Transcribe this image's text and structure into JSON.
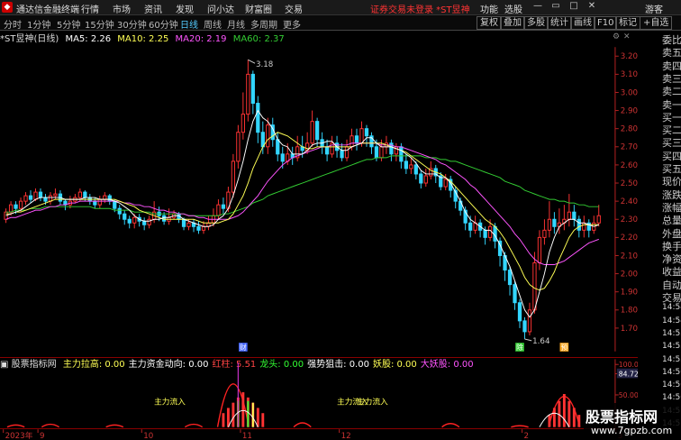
{
  "titlebar": {
    "app_name": "通达信金融终端",
    "menus": [
      "行情",
      "市场",
      "资讯",
      "发现",
      "问小达",
      "财富圈",
      "交易"
    ],
    "alert": "证券交易未登录 *ST昱神",
    "right_menus": [
      "功能",
      "选股",
      "游客"
    ]
  },
  "toolbar": {
    "periods": [
      "分时",
      "1分钟",
      "5分钟",
      "15分钟",
      "30分钟",
      "60分钟",
      "日线",
      "周线",
      "月线",
      "多周期",
      "更多"
    ],
    "active_period": "日线",
    "tools": [
      "复权",
      "叠加",
      "多股",
      "统计",
      "画线",
      "F10",
      "标记"
    ],
    "self_select": "+自选"
  },
  "chart_info": {
    "stock": "*ST昱神(日线)",
    "ma5_label": "MA5: 2.26",
    "ma10_label": "MA10: 2.25",
    "ma20_label": "MA20: 2.19",
    "ma60_label": "MA60: 2.37"
  },
  "colors": {
    "up": "#ff3333",
    "down": "#33d6ff",
    "ma5": "#ffffff",
    "ma10": "#ffff55",
    "ma20": "#ff55ff",
    "ma60": "#33cc33",
    "axis": "#cc2222"
  },
  "price_axis": [
    "3.20",
    "3.10",
    "3.00",
    "2.90",
    "2.80",
    "2.70",
    "2.60",
    "2.50",
    "2.40",
    "2.30",
    "2.20",
    "2.10",
    "2.00",
    "1.90",
    "1.80",
    "1.70"
  ],
  "annotations": {
    "high": "3.18",
    "low": "1.64"
  },
  "markers": [
    "财",
    "除",
    "预"
  ],
  "indicator": {
    "name": "股票指标网",
    "items": [
      {
        "label": "主力拉高:",
        "value": "0.00",
        "color": "#ffff55"
      },
      {
        "label": "主力资金动向:",
        "value": "0.00",
        "color": "#ffffff"
      },
      {
        "label": "红柱:",
        "value": "5.51",
        "color": "#ff4444"
      },
      {
        "label": "龙头:",
        "value": "0.00",
        "color": "#33ff33"
      },
      {
        "label": "强势狙击:",
        "value": "0.00",
        "color": "#ffffff"
      },
      {
        "label": "妖股:",
        "value": "0.00",
        "color": "#ffff55"
      },
      {
        "label": "大妖股:",
        "value": "0.00",
        "color": "#ff55ff"
      }
    ],
    "axis": [
      "100.00",
      "84.72",
      "50.00"
    ],
    "flow_labels": [
      "主力流入",
      "主力流入",
      "主力流入"
    ]
  },
  "date_axis": [
    "2023年",
    "9",
    "10",
    "11",
    "12",
    "2",
    "3"
  ],
  "right_panel": [
    "委比",
    "卖五",
    "卖四",
    "卖三",
    "卖二",
    "卖一",
    "买一",
    "买二",
    "买三",
    "买四",
    "买五",
    "现价",
    "涨跌",
    "涨幅",
    "总量",
    "外盘",
    "换手",
    "净资",
    "收益",
    "自动",
    "交易",
    "14:54",
    "14:54",
    "14:55",
    "14:55",
    "14:55",
    "14:56",
    "14:56",
    "14:56",
    "14:5",
    "14:5"
  ],
  "watermark": {
    "title": "股票指标网",
    "url": "www.7gpzb.com"
  },
  "chart_data": {
    "type": "candlestick",
    "x": [
      "2023-08",
      "2023-09",
      "2023-10",
      "2023-11",
      "2023-12",
      "2024-01",
      "2024-02",
      "2024-03"
    ],
    "candles": [
      [
        2.3,
        2.34,
        2.36,
        2.28
      ],
      [
        2.34,
        2.38,
        2.4,
        2.32
      ],
      [
        2.38,
        2.36,
        2.4,
        2.33
      ],
      [
        2.36,
        2.4,
        2.42,
        2.34
      ],
      [
        2.4,
        2.43,
        2.45,
        2.38
      ],
      [
        2.43,
        2.41,
        2.46,
        2.39
      ],
      [
        2.41,
        2.45,
        2.47,
        2.4
      ],
      [
        2.45,
        2.42,
        2.47,
        2.4
      ],
      [
        2.42,
        2.4,
        2.44,
        2.38
      ],
      [
        2.4,
        2.43,
        2.45,
        2.38
      ],
      [
        2.43,
        2.44,
        2.47,
        2.41
      ],
      [
        2.44,
        2.4,
        2.46,
        2.38
      ],
      [
        2.4,
        2.38,
        2.41,
        2.35
      ],
      [
        2.38,
        2.4,
        2.43,
        2.36
      ],
      [
        2.4,
        2.42,
        2.44,
        2.39
      ],
      [
        2.42,
        2.45,
        2.47,
        2.4
      ],
      [
        2.45,
        2.42,
        2.46,
        2.4
      ],
      [
        2.42,
        2.4,
        2.44,
        2.38
      ],
      [
        2.4,
        2.38,
        2.42,
        2.36
      ],
      [
        2.38,
        2.41,
        2.43,
        2.36
      ],
      [
        2.41,
        2.43,
        2.45,
        2.39
      ],
      [
        2.43,
        2.4,
        2.44,
        2.38
      ],
      [
        2.4,
        2.36,
        2.41,
        2.34
      ],
      [
        2.36,
        2.33,
        2.38,
        2.3
      ],
      [
        2.33,
        2.3,
        2.35,
        2.27
      ],
      [
        2.3,
        2.28,
        2.32,
        2.25
      ],
      [
        2.28,
        2.31,
        2.33,
        2.25
      ],
      [
        2.31,
        2.29,
        2.33,
        2.26
      ],
      [
        2.29,
        2.27,
        2.31,
        2.24
      ],
      [
        2.27,
        2.3,
        2.32,
        2.25
      ],
      [
        2.3,
        2.34,
        2.4,
        2.28
      ],
      [
        2.34,
        2.32,
        2.37,
        2.29
      ],
      [
        2.32,
        2.29,
        2.34,
        2.27
      ],
      [
        2.29,
        2.31,
        2.36,
        2.27
      ],
      [
        2.31,
        2.33,
        2.35,
        2.3
      ],
      [
        2.33,
        2.3,
        2.34,
        2.28
      ],
      [
        2.3,
        2.26,
        2.31,
        2.24
      ],
      [
        2.26,
        2.28,
        2.3,
        2.24
      ],
      [
        2.28,
        2.26,
        2.3,
        2.23
      ],
      [
        2.26,
        2.24,
        2.29,
        2.22
      ],
      [
        2.24,
        2.26,
        2.29,
        2.22
      ],
      [
        2.26,
        2.28,
        2.32,
        2.24
      ],
      [
        2.28,
        2.32,
        2.36,
        2.26
      ],
      [
        2.32,
        2.38,
        2.41,
        2.3
      ],
      [
        2.38,
        2.36,
        2.42,
        2.33
      ],
      [
        2.36,
        2.45,
        2.48,
        2.34
      ],
      [
        2.45,
        2.62,
        2.66,
        2.42
      ],
      [
        2.62,
        2.78,
        2.82,
        2.58
      ],
      [
        2.78,
        2.88,
        3.0,
        2.74
      ],
      [
        2.88,
        3.1,
        3.18,
        2.84
      ],
      [
        3.1,
        2.94,
        3.12,
        2.88
      ],
      [
        2.94,
        2.78,
        2.98,
        2.72
      ],
      [
        2.78,
        2.7,
        2.84,
        2.66
      ],
      [
        2.7,
        2.82,
        2.86,
        2.66
      ],
      [
        2.82,
        2.74,
        2.86,
        2.7
      ],
      [
        2.74,
        2.66,
        2.78,
        2.62
      ],
      [
        2.66,
        2.62,
        2.7,
        2.58
      ],
      [
        2.62,
        2.66,
        2.72,
        2.6
      ],
      [
        2.66,
        2.64,
        2.7,
        2.6
      ],
      [
        2.64,
        2.7,
        2.76,
        2.62
      ],
      [
        2.7,
        2.68,
        2.76,
        2.64
      ],
      [
        2.68,
        2.72,
        2.78,
        2.66
      ],
      [
        2.72,
        2.84,
        2.9,
        2.7
      ],
      [
        2.84,
        2.74,
        2.86,
        2.7
      ],
      [
        2.74,
        2.7,
        2.78,
        2.66
      ],
      [
        2.7,
        2.66,
        2.74,
        2.62
      ],
      [
        2.66,
        2.72,
        2.76,
        2.64
      ],
      [
        2.72,
        2.68,
        2.76,
        2.64
      ],
      [
        2.68,
        2.64,
        2.72,
        2.62
      ],
      [
        2.64,
        2.7,
        2.74,
        2.62
      ],
      [
        2.7,
        2.76,
        2.8,
        2.68
      ],
      [
        2.76,
        2.72,
        2.8,
        2.68
      ],
      [
        2.72,
        2.8,
        2.84,
        2.7
      ],
      [
        2.8,
        2.76,
        2.82,
        2.7
      ],
      [
        2.76,
        2.7,
        2.78,
        2.66
      ],
      [
        2.7,
        2.64,
        2.74,
        2.62
      ],
      [
        2.64,
        2.7,
        2.74,
        2.62
      ],
      [
        2.7,
        2.72,
        2.76,
        2.66
      ],
      [
        2.72,
        2.66,
        2.74,
        2.62
      ],
      [
        2.66,
        2.7,
        2.72,
        2.62
      ],
      [
        2.7,
        2.62,
        2.72,
        2.58
      ],
      [
        2.62,
        2.58,
        2.66,
        2.55
      ],
      [
        2.58,
        2.6,
        2.64,
        2.55
      ],
      [
        2.6,
        2.55,
        2.62,
        2.52
      ],
      [
        2.55,
        2.5,
        2.57,
        2.47
      ],
      [
        2.5,
        2.54,
        2.58,
        2.48
      ],
      [
        2.54,
        2.58,
        2.62,
        2.52
      ],
      [
        2.58,
        2.54,
        2.6,
        2.5
      ],
      [
        2.54,
        2.48,
        2.56,
        2.46
      ],
      [
        2.48,
        2.52,
        2.55,
        2.46
      ],
      [
        2.52,
        2.46,
        2.54,
        2.42
      ],
      [
        2.46,
        2.4,
        2.48,
        2.36
      ],
      [
        2.4,
        2.35,
        2.42,
        2.32
      ],
      [
        2.35,
        2.28,
        2.37,
        2.24
      ],
      [
        2.28,
        2.24,
        2.32,
        2.2
      ],
      [
        2.24,
        2.28,
        2.32,
        2.22
      ],
      [
        2.28,
        2.24,
        2.3,
        2.2
      ],
      [
        2.24,
        2.2,
        2.26,
        2.16
      ],
      [
        2.2,
        2.26,
        2.3,
        2.18
      ],
      [
        2.26,
        2.18,
        2.28,
        2.14
      ],
      [
        2.18,
        2.1,
        2.2,
        2.04
      ],
      [
        2.1,
        2.02,
        2.12,
        1.96
      ],
      [
        2.02,
        1.94,
        2.04,
        1.88
      ],
      [
        1.94,
        1.84,
        1.96,
        1.8
      ],
      [
        1.84,
        1.74,
        1.86,
        1.7
      ],
      [
        1.74,
        1.68,
        1.76,
        1.64
      ],
      [
        1.68,
        1.8,
        1.84,
        1.66
      ],
      [
        1.8,
        2.06,
        2.12,
        1.78
      ],
      [
        2.06,
        2.2,
        2.24,
        2.02
      ],
      [
        2.2,
        2.24,
        2.3,
        2.16
      ],
      [
        2.24,
        2.3,
        2.4,
        2.2
      ],
      [
        2.3,
        2.26,
        2.34,
        2.22
      ],
      [
        2.26,
        2.28,
        2.36,
        2.22
      ],
      [
        2.28,
        2.3,
        2.38,
        2.24
      ],
      [
        2.3,
        2.34,
        2.44,
        2.26
      ],
      [
        2.34,
        2.3,
        2.38,
        2.26
      ],
      [
        2.3,
        2.24,
        2.32,
        2.2
      ],
      [
        2.24,
        2.28,
        2.32,
        2.2
      ],
      [
        2.28,
        2.24,
        2.3,
        2.2
      ],
      [
        2.24,
        2.28,
        2.32,
        2.22
      ],
      [
        2.28,
        2.32,
        2.38,
        2.26
      ]
    ],
    "ma5": [
      2.32,
      2.33,
      2.34,
      2.35,
      2.37,
      2.39,
      2.41,
      2.42,
      2.42,
      2.42,
      2.42,
      2.42,
      2.41,
      2.41,
      2.41,
      2.41,
      2.42,
      2.42,
      2.42,
      2.41,
      2.41,
      2.41,
      2.4,
      2.39,
      2.37,
      2.35,
      2.32,
      2.3,
      2.29,
      2.29,
      2.3,
      2.3,
      2.31,
      2.31,
      2.32,
      2.32,
      2.3,
      2.29,
      2.28,
      2.27,
      2.26,
      2.26,
      2.27,
      2.3,
      2.32,
      2.36,
      2.43,
      2.52,
      2.62,
      2.74,
      2.84,
      2.9,
      2.86,
      2.84,
      2.8,
      2.74,
      2.71,
      2.7,
      2.66,
      2.66,
      2.66,
      2.68,
      2.71,
      2.72,
      2.72,
      2.73,
      2.73,
      2.7,
      2.68,
      2.68,
      2.7,
      2.71,
      2.72,
      2.75,
      2.75,
      2.72,
      2.7,
      2.7,
      2.7,
      2.69,
      2.68,
      2.66,
      2.64,
      2.61,
      2.57,
      2.55,
      2.55,
      2.55,
      2.53,
      2.53,
      2.5,
      2.45,
      2.4,
      2.34,
      2.3,
      2.28,
      2.26,
      2.24,
      2.24,
      2.21,
      2.16,
      2.1,
      2.04,
      1.96,
      1.88,
      1.8,
      1.76,
      1.8,
      1.9,
      2.0,
      2.12,
      2.2,
      2.26,
      2.28,
      2.3,
      2.3,
      2.28,
      2.28,
      2.27,
      2.26,
      2.27
    ],
    "ma10": [
      2.33,
      2.33,
      2.34,
      2.34,
      2.35,
      2.36,
      2.37,
      2.38,
      2.39,
      2.4,
      2.41,
      2.41,
      2.41,
      2.41,
      2.41,
      2.41,
      2.41,
      2.41,
      2.41,
      2.41,
      2.41,
      2.41,
      2.41,
      2.4,
      2.39,
      2.38,
      2.37,
      2.35,
      2.34,
      2.33,
      2.32,
      2.31,
      2.3,
      2.3,
      2.3,
      2.3,
      2.3,
      2.3,
      2.3,
      2.29,
      2.28,
      2.28,
      2.28,
      2.28,
      2.29,
      2.3,
      2.33,
      2.38,
      2.43,
      2.5,
      2.58,
      2.64,
      2.7,
      2.74,
      2.76,
      2.78,
      2.77,
      2.76,
      2.74,
      2.72,
      2.7,
      2.69,
      2.69,
      2.7,
      2.7,
      2.7,
      2.7,
      2.7,
      2.7,
      2.7,
      2.7,
      2.71,
      2.72,
      2.72,
      2.72,
      2.72,
      2.72,
      2.71,
      2.7,
      2.69,
      2.68,
      2.67,
      2.65,
      2.63,
      2.61,
      2.59,
      2.57,
      2.56,
      2.55,
      2.53,
      2.51,
      2.48,
      2.45,
      2.42,
      2.39,
      2.36,
      2.33,
      2.3,
      2.28,
      2.26,
      2.23,
      2.19,
      2.14,
      2.09,
      2.04,
      1.98,
      1.94,
      1.92,
      1.91,
      1.92,
      1.96,
      2.01,
      2.08,
      2.14,
      2.2,
      2.24,
      2.26,
      2.27,
      2.27,
      2.27,
      2.27
    ],
    "ma20": [
      2.3,
      2.31,
      2.31,
      2.32,
      2.33,
      2.34,
      2.35,
      2.35,
      2.36,
      2.37,
      2.37,
      2.38,
      2.38,
      2.39,
      2.39,
      2.4,
      2.4,
      2.4,
      2.4,
      2.4,
      2.4,
      2.4,
      2.4,
      2.4,
      2.39,
      2.39,
      2.38,
      2.38,
      2.37,
      2.37,
      2.36,
      2.35,
      2.35,
      2.34,
      2.34,
      2.33,
      2.33,
      2.32,
      2.32,
      2.31,
      2.31,
      2.3,
      2.3,
      2.3,
      2.3,
      2.3,
      2.31,
      2.32,
      2.34,
      2.37,
      2.4,
      2.43,
      2.47,
      2.51,
      2.54,
      2.57,
      2.6,
      2.62,
      2.64,
      2.65,
      2.66,
      2.67,
      2.68,
      2.69,
      2.7,
      2.7,
      2.71,
      2.71,
      2.71,
      2.71,
      2.72,
      2.72,
      2.72,
      2.72,
      2.72,
      2.72,
      2.71,
      2.71,
      2.71,
      2.7,
      2.7,
      2.69,
      2.68,
      2.67,
      2.66,
      2.65,
      2.64,
      2.63,
      2.61,
      2.6,
      2.58,
      2.56,
      2.54,
      2.52,
      2.49,
      2.47,
      2.44,
      2.41,
      2.38,
      2.35,
      2.32,
      2.29,
      2.26,
      2.22,
      2.19,
      2.15,
      2.11,
      2.08,
      2.06,
      2.05,
      2.05,
      2.05,
      2.06,
      2.07,
      2.09,
      2.11,
      2.13,
      2.15,
      2.17,
      2.18,
      2.19
    ],
    "ma60": [
      2.34,
      2.34,
      2.35,
      2.35,
      2.35,
      2.36,
      2.36,
      2.36,
      2.37,
      2.37,
      2.37,
      2.37,
      2.37,
      2.37,
      2.37,
      2.37,
      2.37,
      2.37,
      2.36,
      2.36,
      2.36,
      2.36,
      2.35,
      2.35,
      2.35,
      2.35,
      2.34,
      2.34,
      2.34,
      2.34,
      2.33,
      2.33,
      2.33,
      2.33,
      2.33,
      2.33,
      2.33,
      2.32,
      2.32,
      2.32,
      2.32,
      2.32,
      2.32,
      2.32,
      2.33,
      2.33,
      2.34,
      2.35,
      2.36,
      2.37,
      2.39,
      2.4,
      2.41,
      2.43,
      2.44,
      2.45,
      2.46,
      2.47,
      2.48,
      2.49,
      2.5,
      2.51,
      2.52,
      2.53,
      2.54,
      2.55,
      2.56,
      2.57,
      2.58,
      2.59,
      2.6,
      2.61,
      2.62,
      2.63,
      2.63,
      2.64,
      2.64,
      2.64,
      2.65,
      2.65,
      2.65,
      2.65,
      2.65,
      2.65,
      2.65,
      2.64,
      2.64,
      2.64,
      2.63,
      2.63,
      2.62,
      2.62,
      2.61,
      2.6,
      2.59,
      2.58,
      2.57,
      2.56,
      2.55,
      2.54,
      2.53,
      2.51,
      2.5,
      2.49,
      2.48,
      2.46,
      2.45,
      2.44,
      2.43,
      2.42,
      2.41,
      2.41,
      2.4,
      2.4,
      2.39,
      2.39,
      2.38,
      2.38,
      2.37,
      2.37,
      2.37
    ],
    "ylim": [
      1.6,
      3.25
    ],
    "high": 3.18,
    "low": 1.64
  }
}
